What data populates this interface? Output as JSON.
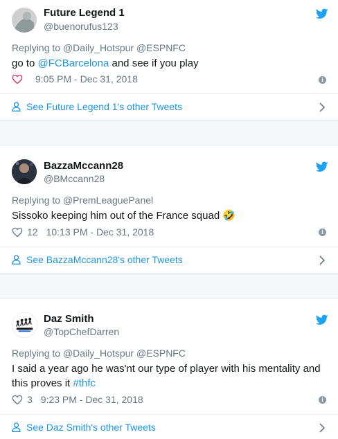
{
  "colors": {
    "link": "#1b95e0",
    "secondary": "#657786",
    "like_red": "#e0245e",
    "bird": "#1da1f2"
  },
  "tweets": [
    {
      "name": "Future Legend 1",
      "handle": "@buenorufus123",
      "reply_prefix": "Replying to",
      "reply_to_1": "@Daily_Hotspur",
      "reply_to_2": "@ESPNFC",
      "text_1": "go to",
      "text_link": "@FCBarcelona",
      "text_2": "and see if you play",
      "likes": "",
      "time": "9:05 PM - Dec 31, 2018",
      "more": "See Future Legend 1's other Tweets",
      "avatar_icon": "user-avatar-icon"
    },
    {
      "name": "BazzaMccann28",
      "handle": "@BMccann28",
      "reply_prefix": "Replying to",
      "reply_to_1": "@PremLeaguePanel",
      "text_1": "Sissoko keeping him out of the France squad",
      "emoji": "🤣",
      "likes": "12",
      "time": "10:13 PM - Dec 31, 2018",
      "more": "See BazzaMccann28's other Tweets",
      "avatar_icon": "user-avatar-icon"
    },
    {
      "name": "Daz Smith",
      "handle": "@TopChefDarren",
      "reply_prefix": "Replying to",
      "reply_to_1": "@Daily_Hotspur",
      "reply_to_2": "@ESPNFC",
      "text_1": "I said a year ago he was'nt our type of player with his mentality and this proves it",
      "text_link": "#thfc",
      "likes": "3",
      "time": "9:23 PM - Dec 31, 2018",
      "more": "See Daz Smith's other Tweets",
      "avatar_icon": "evolution-skills-logo-icon"
    }
  ]
}
